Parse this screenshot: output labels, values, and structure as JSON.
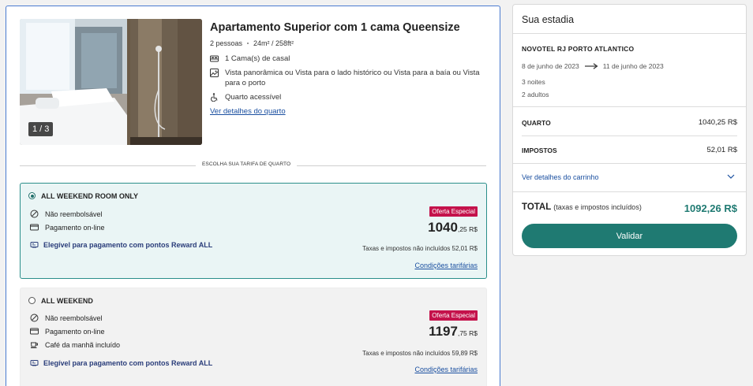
{
  "room": {
    "title": "Apartamento Superior com 1 cama Queensize",
    "guests": "2 pessoas",
    "size": "24m² / 258ft²",
    "photo_counter": "1 / 3",
    "features": [
      {
        "icon": "bed-icon",
        "text": "1 Cama(s) de casal"
      },
      {
        "icon": "view-icon",
        "text": "Vista panorâmica ou Vista para o lado histórico ou Vista para a baía ou Vista para o porto"
      },
      {
        "icon": "accessible-icon",
        "text": "Quarto acessível"
      }
    ],
    "details_link": "Ver detalhes do quarto"
  },
  "divider_label": "ESCOLHA SUA TARIFA DE QUARTO",
  "rates": [
    {
      "name": "ALL WEEKEND ROOM ONLY",
      "selected": true,
      "lines": [
        "Não reembolsável",
        "Pagamento on-line"
      ],
      "reward": "Elegível para pagamento com pontos Reward ALL",
      "badge": "Oferta Especial",
      "price_int": "1040",
      "price_dec": ",25 R$",
      "tax_note": "Taxas e impostos não incluídos 52,01 R$",
      "conditions": "Condições tarifárias"
    },
    {
      "name": "ALL WEEKEND",
      "selected": false,
      "lines": [
        "Não reembolsável",
        "Pagamento on-line",
        "Café da manhã incluído"
      ],
      "reward": "Elegível para pagamento com pontos Reward ALL",
      "badge": "Oferta Especial",
      "price_int": "1197",
      "price_dec": ",75 R$",
      "tax_note": "Taxas e impostos não incluídos 59,89 R$",
      "conditions": "Condições tarifárias"
    }
  ],
  "stay": {
    "title": "Sua estadia",
    "hotel": "NOVOTEL RJ PORTO ATLANTICO",
    "date_from": "8 de junho de 2023",
    "date_to": "11 de junho de 2023",
    "nights": "3 noites",
    "adults": "2 adultos",
    "room_label": "QUARTO",
    "room_value": "1040,25 R$",
    "tax_label": "IMPOSTOS",
    "tax_value": "52,01 R$",
    "cart_link": "Ver detalhes do carrinho",
    "total_label": "TOTAL",
    "total_note": "(taxas e impostos incluídos)",
    "total_value": "1092,26 R$",
    "validate": "Validar"
  },
  "colors": {
    "accent": "#1f7a72",
    "badge": "#c4124b",
    "link": "#1a4fa0",
    "selected_bg": "#eaf5f5"
  }
}
